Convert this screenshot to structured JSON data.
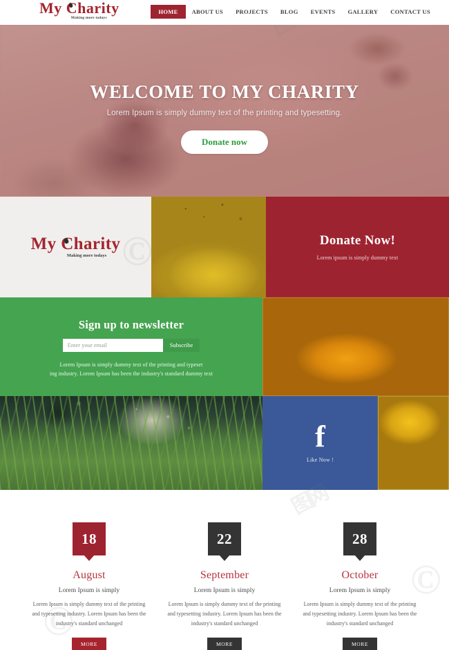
{
  "site": {
    "logo_name": "My Charity",
    "logo_name_part1": "My ",
    "logo_name_part2": "C",
    "logo_name_part3": "harity",
    "tagline": "Making more todays"
  },
  "colors": {
    "brand_red": "#9e2330",
    "brand_red_dark": "#a4252f",
    "green": "#45a450",
    "facebook_blue": "#3b5998",
    "dark": "#343434",
    "light_gray": "#f0efed"
  },
  "nav": {
    "items": [
      {
        "label": "HOME",
        "active": true
      },
      {
        "label": "ABOUT US",
        "active": false
      },
      {
        "label": "PROJECTS",
        "active": false
      },
      {
        "label": "BLOG",
        "active": false
      },
      {
        "label": "EVENTS",
        "active": false
      },
      {
        "label": "GALLERY",
        "active": false
      },
      {
        "label": "CONTACT US",
        "active": false
      }
    ]
  },
  "hero": {
    "title": "WELCOME TO MY CHARITY",
    "subtitle": "Lorem Ipsum is simply dummy text of the printing and typesetting.",
    "cta_label": "Donate now"
  },
  "donate_panel": {
    "title": "Donate Now!",
    "subtitle": "Lorem ipsum is simply dummy text"
  },
  "newsletter": {
    "title": "Sign up to newsletter",
    "input_placeholder": "Enter your email",
    "input_value": "",
    "submit_label": "Subscribe",
    "body_line1": "Lorem Ipsum is simply dummy text of the printing and typeset",
    "body_line2": "ing industry. Lorem Ipsum has been the industry's standard dummy text"
  },
  "facebook": {
    "glyph": "f",
    "label": "Like Now !"
  },
  "events": {
    "items": [
      {
        "day": "18",
        "month": "August",
        "lead": "Lorem Ipsum is simply",
        "body": "Lorem Ipsum is simply dummy text of the printing and typesetting industry. Lorem Ipsum has been the industry's standard unchanged",
        "more_label": "MORE",
        "style": "red"
      },
      {
        "day": "22",
        "month": "September",
        "lead": "Lorem Ipsum is simply",
        "body": "Lorem Ipsum is simply dummy text of the printing and typesetting industry. Lorem Ipsum has been the industry's standard unchanged",
        "more_label": "MORE",
        "style": "dark"
      },
      {
        "day": "28",
        "month": "October",
        "lead": "Lorem Ipsum is simply",
        "body": "Lorem Ipsum is simply dummy text of the printing and typesetting industry. Lorem Ipsum has been the industry's standard unchanged",
        "more_label": "MORE",
        "style": "dark"
      }
    ]
  }
}
